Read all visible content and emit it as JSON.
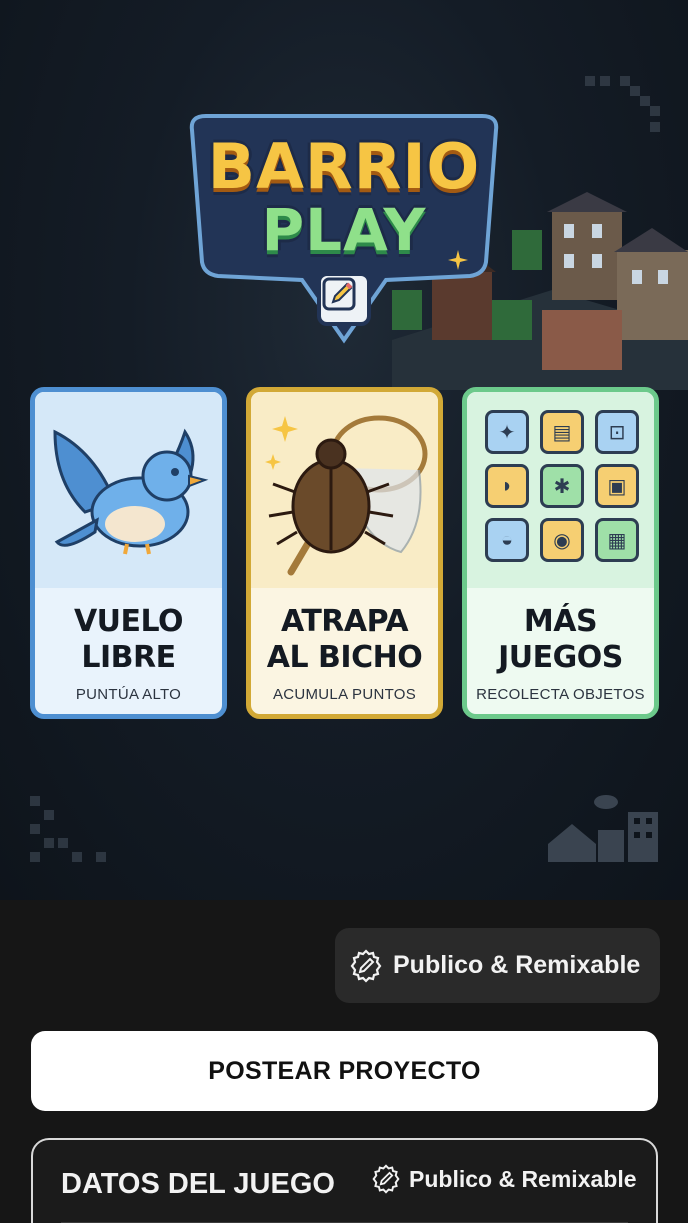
{
  "logo": {
    "line1": "BARRIO",
    "line2": "PLAY",
    "icon": "edit-icon"
  },
  "games": [
    {
      "title_line1": "VUELO",
      "title_line2": "LIBRE",
      "subtitle": "PUNTÚA ALTO",
      "icon": "bird-icon",
      "accent": "#4e8fd1"
    },
    {
      "title_line1": "ATRAPA",
      "title_line2": "AL BICHO",
      "subtitle": "ACUMULA PUNTOS",
      "icon": "beetle-net-icon",
      "accent": "#d2a936"
    },
    {
      "title_line1": "MÁS",
      "title_line2": "JUEGOS",
      "subtitle": "RECOLECTA OBJETOS",
      "icon": "games-grid-icon",
      "accent": "#6cc98b"
    }
  ],
  "mini_game_icons": [
    "bird-icon",
    "map-icon",
    "mailbox-icon",
    "horn-icon",
    "bug-icon",
    "picture-icon",
    "teapot-icon",
    "coin-icon",
    "grid-icon"
  ],
  "visibility": {
    "label": "Publico & Remixable",
    "icon": "remix-icon"
  },
  "post_button": {
    "label": "POSTEAR PROYECTO"
  },
  "game_data": {
    "title": "DATOS DEL JUEGO",
    "visibility_label": "Publico & Remixable"
  },
  "colors": {
    "logo_yellow": "#f6c544",
    "logo_green": "#8fe08a",
    "panel_bg": "#161616",
    "button_bg": "#ffffff"
  }
}
